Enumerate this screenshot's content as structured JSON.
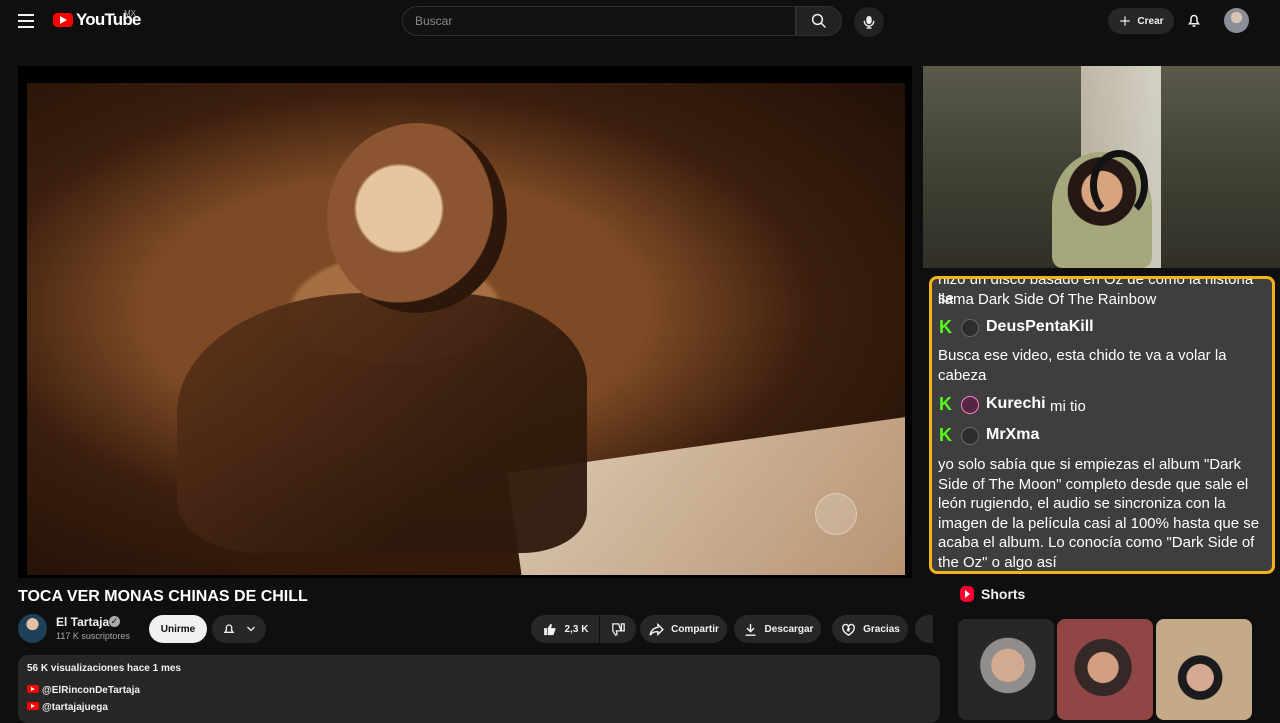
{
  "header": {
    "logo_text": "YouTube",
    "country_code": "MX",
    "search_placeholder": "Buscar",
    "create_label": "Crear"
  },
  "video": {
    "title": "TOCA VER MONAS CHINAS DE CHILL"
  },
  "channel": {
    "name": "El Tartaja",
    "subscribers": "117 K suscriptores",
    "join_label": "Unirme"
  },
  "actions": {
    "likes": "2,3 K",
    "share_label": "Compartir",
    "download_label": "Descargar",
    "thanks_label": "Gracias"
  },
  "description": {
    "stats": "56 K visualizaciones  hace 1 mes",
    "links": [
      "@ElRinconDeTartaja",
      "@tartajajuega"
    ]
  },
  "chat": {
    "messages": [
      {
        "text": "hizo un disco basado en Oz de como la historia se"
      },
      {
        "text": "llama Dark Side Of The Rainbow"
      },
      {
        "user": "DeusPentaKill",
        "text": "Busca ese video, esta chido te va a volar la"
      },
      {
        "text": "cabeza"
      },
      {
        "user": "Kurechi",
        "text": "mi tio"
      },
      {
        "user": "MrXma",
        "text": "yo solo sabía que si empiezas el album \"Dark"
      },
      {
        "text": "Side of The Moon\" completo desde que sale el"
      },
      {
        "text": "león rugiendo, el audio se sincroniza con la"
      },
      {
        "text": "imagen de la película casi al 100% hasta que se"
      },
      {
        "text": "acaba el album. Lo conocía como \"Dark Side of"
      },
      {
        "text": "the Oz\" o algo así"
      }
    ]
  },
  "shorts": {
    "title": "Shorts"
  }
}
